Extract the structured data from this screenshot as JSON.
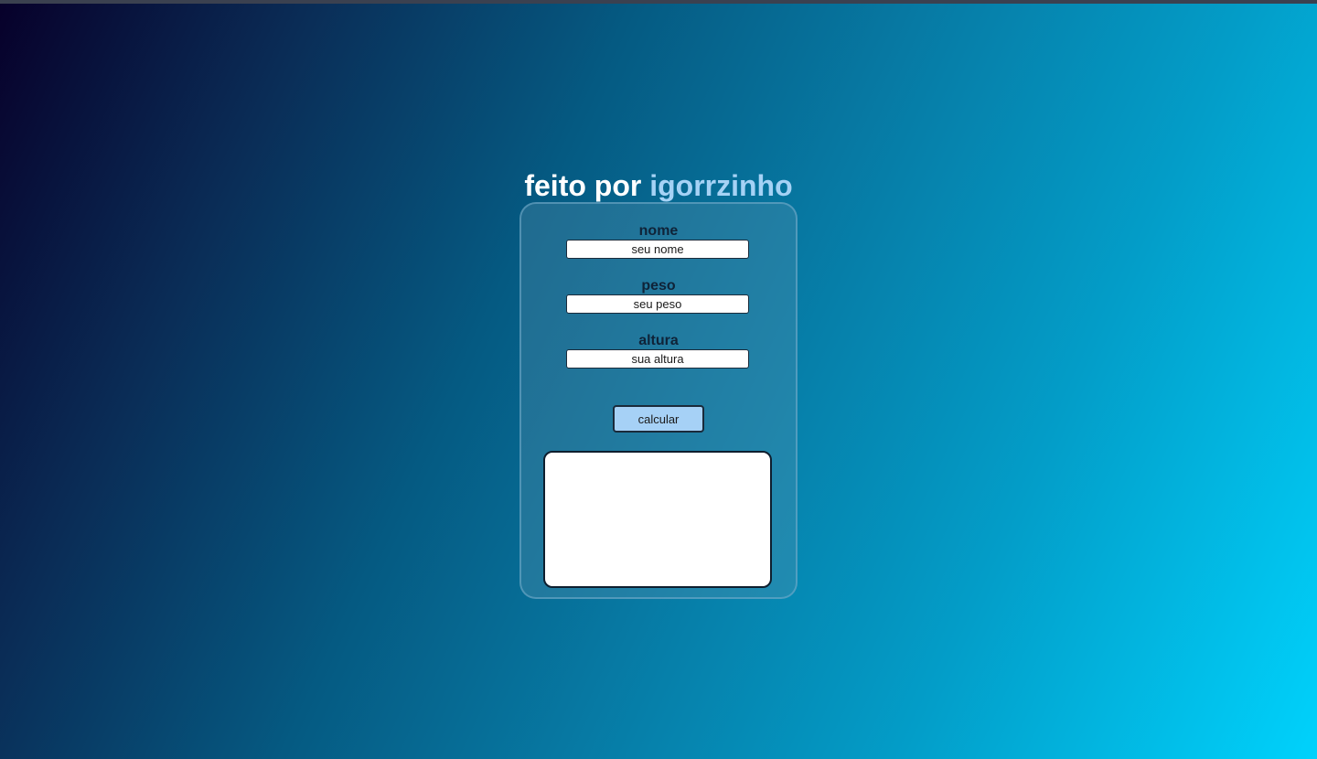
{
  "page": {
    "title_prefix": "feito por",
    "author": "igorrzinho"
  },
  "form": {
    "fields": [
      {
        "label": "nome",
        "placeholder": "seu nome"
      },
      {
        "label": "peso",
        "placeholder": "seu peso"
      },
      {
        "label": "altura",
        "placeholder": "sua altura"
      }
    ],
    "calculate_label": "calcular",
    "result": ""
  },
  "colors": {
    "gradient_start": "#07002a",
    "gradient_end": "#00d2fc",
    "author_accent": "#a5d2f5",
    "button_background": "#a6d1f6"
  }
}
